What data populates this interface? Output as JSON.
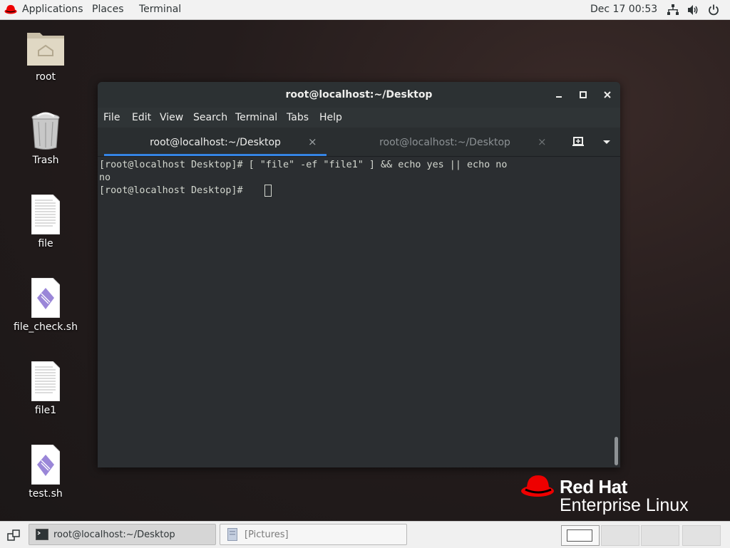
{
  "topbar": {
    "applications": "Applications",
    "places": "Places",
    "terminal": "Terminal",
    "clock": "Dec 17  00:53",
    "icons": [
      "network-icon",
      "volume-icon",
      "power-icon"
    ]
  },
  "desktop": {
    "icons": [
      {
        "label": "root",
        "icon": "home-folder-icon"
      },
      {
        "label": "Trash",
        "icon": "trash-icon"
      },
      {
        "label": "file",
        "icon": "text-file-icon"
      },
      {
        "label": "file_check.sh",
        "icon": "script-file-icon"
      },
      {
        "label": "file1",
        "icon": "text-file-icon"
      },
      {
        "label": "test.sh",
        "icon": "script-file-icon"
      }
    ]
  },
  "window": {
    "title": "root@localhost:~/Desktop",
    "menu": [
      "File",
      "Edit",
      "View",
      "Search",
      "Terminal",
      "Tabs",
      "Help"
    ],
    "tabs": [
      {
        "label": "root@localhost:~/Desktop",
        "close": "×",
        "active": true
      },
      {
        "label": "root@localhost:~/Desktop",
        "close": "×",
        "active": false
      }
    ],
    "terminal_lines": [
      "[root@localhost Desktop]# [ \"file\" -ef \"file1\" ] && echo yes || echo no",
      "no",
      "[root@localhost Desktop]# "
    ]
  },
  "branding": {
    "name": "Red Hat",
    "product": "Enterprise Linux",
    "color": "#ee0000"
  },
  "taskbar": {
    "tasks": [
      {
        "label": "root@localhost:~/Desktop",
        "active": true
      },
      {
        "label": "[Pictures]",
        "active": false
      }
    ],
    "workspaces": 4
  }
}
